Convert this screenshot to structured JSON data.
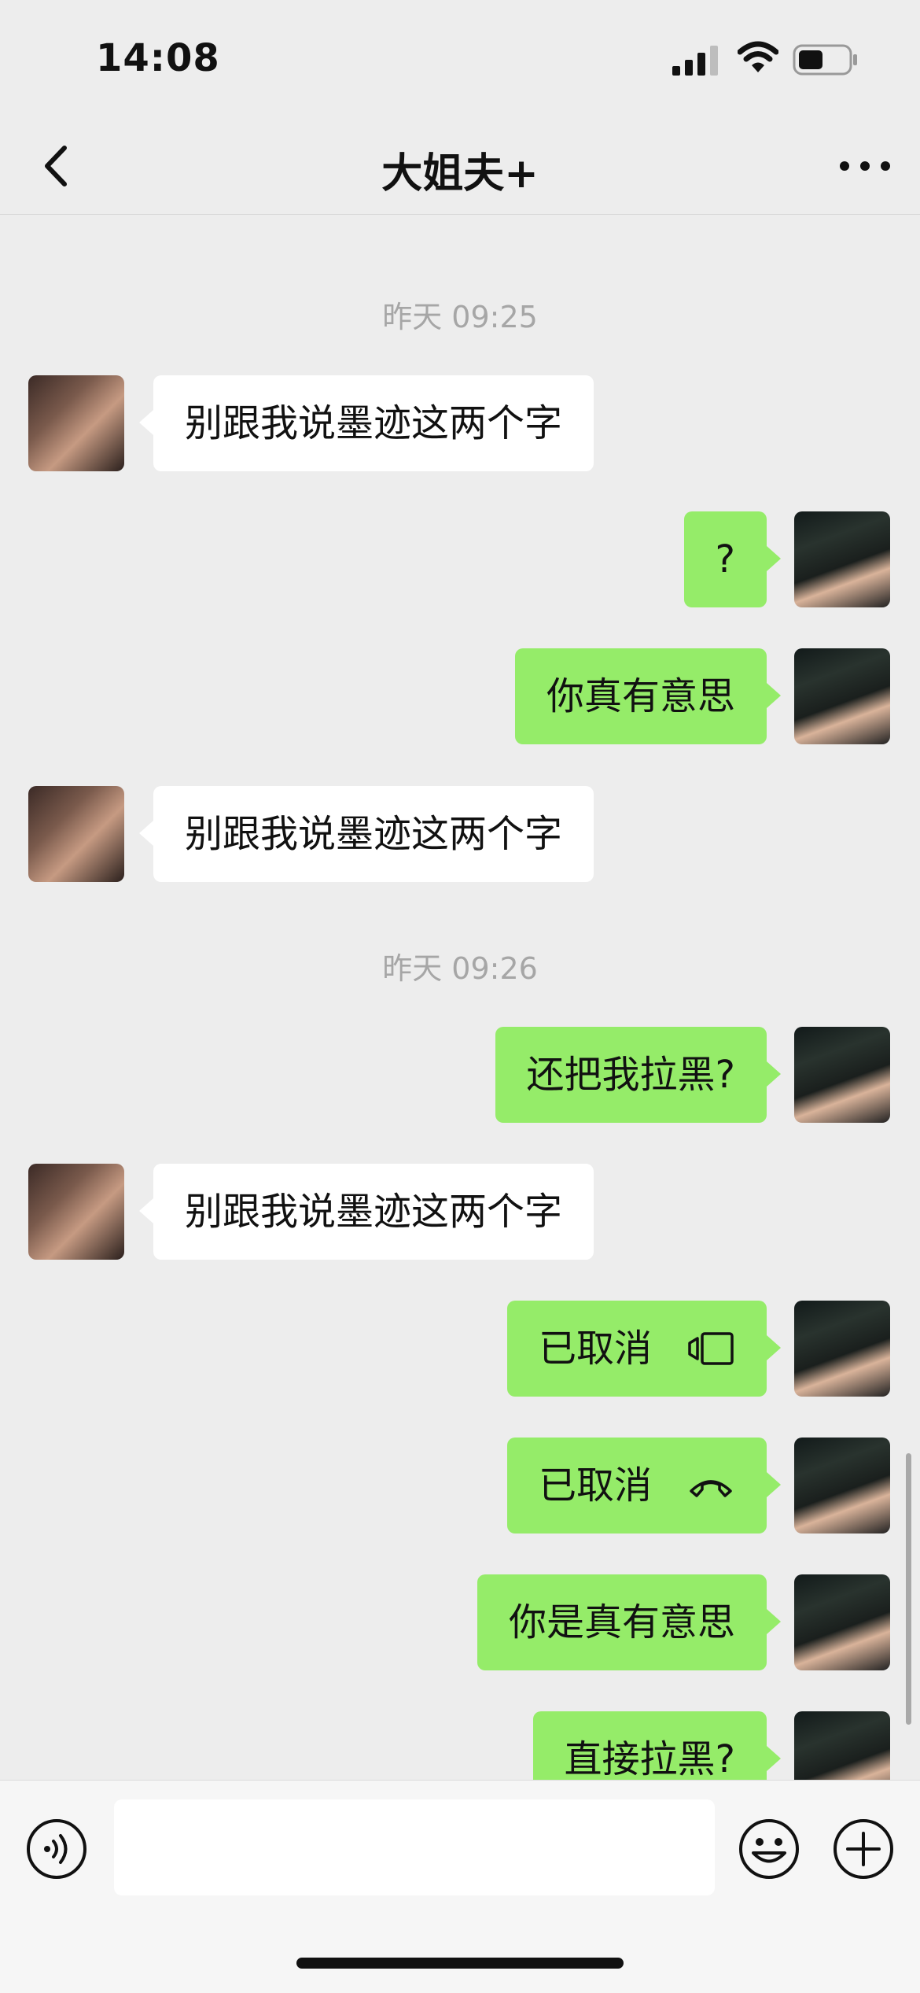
{
  "status_bar": {
    "time": "14:08"
  },
  "nav": {
    "title": "大姐夫+"
  },
  "messages": {
    "timestamp1": "昨天 09:25",
    "m1": "别跟我说墨迹这两个字",
    "m2": "?",
    "m3": "你真有意思",
    "m4": "别跟我说墨迹这两个字",
    "timestamp2": "昨天 09:26",
    "m5": "还把我拉黑?",
    "m6": "别跟我说墨迹这两个字",
    "m7": {
      "text": "已取消",
      "icon": "video-call-icon"
    },
    "m8": {
      "text": "已取消",
      "icon": "phone-call-icon"
    },
    "m9": "你是真有意思",
    "m10": "直接拉黑?"
  },
  "input_bar": {
    "message_value": ""
  },
  "colors": {
    "background": "#ededed",
    "outgoing_bubble": "#95ec69",
    "incoming_bubble": "#ffffff",
    "timestamp": "#a6a6a6"
  }
}
